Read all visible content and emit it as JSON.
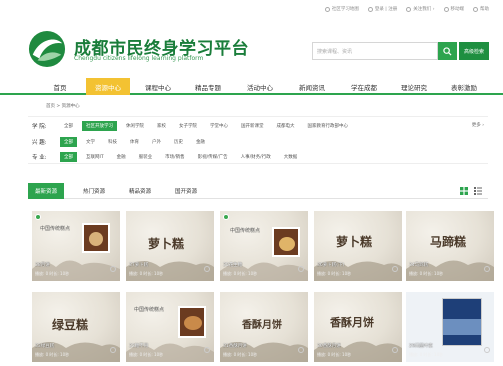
{
  "topbar": {
    "links": [
      "社区学习地图",
      "登录 | 注册",
      "关注我们 ›",
      "移动端",
      "帮助"
    ]
  },
  "header": {
    "brand_cn": "成都市民终身学习平台",
    "brand_en": "Chengdu citizens lifelong learning platform",
    "search_placeholder": "搜索课程、资讯",
    "adv_search_label": "高级检索",
    "colors": {
      "brand": "#1a7d3a",
      "accent": "#2da44e",
      "nav_active": "#f3c232"
    }
  },
  "nav": {
    "items": [
      "首页",
      "资源中心",
      "课程中心",
      "精品专题",
      "活动中心",
      "新闻资讯",
      "学在成都",
      "理论研究",
      "表彰激励"
    ],
    "active_index": 1
  },
  "breadcrumb": "首页 > 资源中心",
  "filters": {
    "rows": [
      {
        "label": "学 院:",
        "options": [
          "全部",
          "社区开放学习",
          "休闲学院",
          "家校",
          "女子学院",
          "学堂中心",
          "国开新课堂",
          "成都电大",
          "国家教育行政部中心"
        ],
        "active": 1
      },
      {
        "label": "兴 趣:",
        "options": [
          "全部",
          "文学",
          "科技",
          "体育",
          "户外",
          "历史",
          "金融"
        ],
        "active": 0
      },
      {
        "label": "专 业:",
        "options": [
          "全部",
          "互联网IT",
          "金融",
          "服装业",
          "市场/销售",
          "影视/传媒/广告",
          "人事/财务/行政",
          "大数据"
        ],
        "active": 0
      }
    ],
    "more_label": "更多 ›"
  },
  "tabs": {
    "items": [
      "最新资源",
      "热门资源",
      "精品资源",
      "国开资源"
    ],
    "active_index": 0
  },
  "cards": [
    {
      "title": "38月饼",
      "stats": "播放: 0  时长: 10秒",
      "art": "中国传统糕点",
      "photo": true
    },
    {
      "title": "37萝卜糕",
      "stats": "播放: 0  时长: 10秒",
      "art": "萝卜糕",
      "photo": false
    },
    {
      "title": "35花生糖",
      "stats": "播放: 0  时长: 10秒",
      "art": "中国传统糕点",
      "photo": true
    },
    {
      "title": "36萝卜糕(下)",
      "stats": "播放: 0  时长: 10秒",
      "art": "萝卜糕",
      "photo": false
    },
    {
      "title": "34马蹄糕",
      "stats": "播放: 0  时长: 10秒",
      "art": "马蹄糕",
      "photo": false
    },
    {
      "title": "33绿豆糕",
      "stats": "播放: 0  时长: 10秒",
      "art": "绿豆糕",
      "photo": false
    },
    {
      "title": "32糖不甩",
      "stats": "播放: 0  时长: 10秒",
      "art": "中国传统糕点",
      "photo": true
    },
    {
      "title": "31香酥月饼",
      "stats": "播放: 0  时长: 10秒",
      "art": "香酥月饼",
      "photo": false
    },
    {
      "title": "30香酥月饼",
      "stats": "播放: 0  时长: 10秒",
      "art": "香酥月饼",
      "photo": false
    },
    {
      "title": "29间画叶家",
      "stats": "播放: 0  时长: 10秒",
      "art": "",
      "photo": false
    }
  ]
}
